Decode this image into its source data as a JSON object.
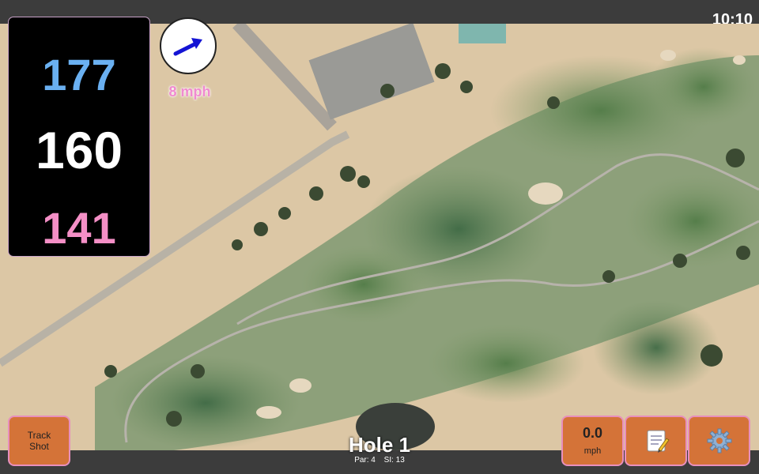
{
  "status": {
    "time": "10:10"
  },
  "yardages": {
    "back": "177",
    "middle": "160",
    "front": "141"
  },
  "wind": {
    "speed": "8 mph",
    "icon": "wind-direction-arrow-icon"
  },
  "buttons": {
    "track_shot": {
      "line1": "Track",
      "line2": "Shot"
    },
    "speed": {
      "value": "0.0",
      "unit": "mph"
    },
    "notes": {
      "icon": "notepad-icon"
    },
    "settings": {
      "icon": "gear-icon"
    }
  },
  "hole": {
    "title": "Hole 1",
    "par": "Par: 4",
    "si": "SI: 13"
  },
  "colors": {
    "back_yardage": "#6ab0f1",
    "middle_yardage": "#ffffff",
    "front_yardage": "#f48fc6",
    "button_bg": "#d47338",
    "button_border": "#e88fbd"
  }
}
